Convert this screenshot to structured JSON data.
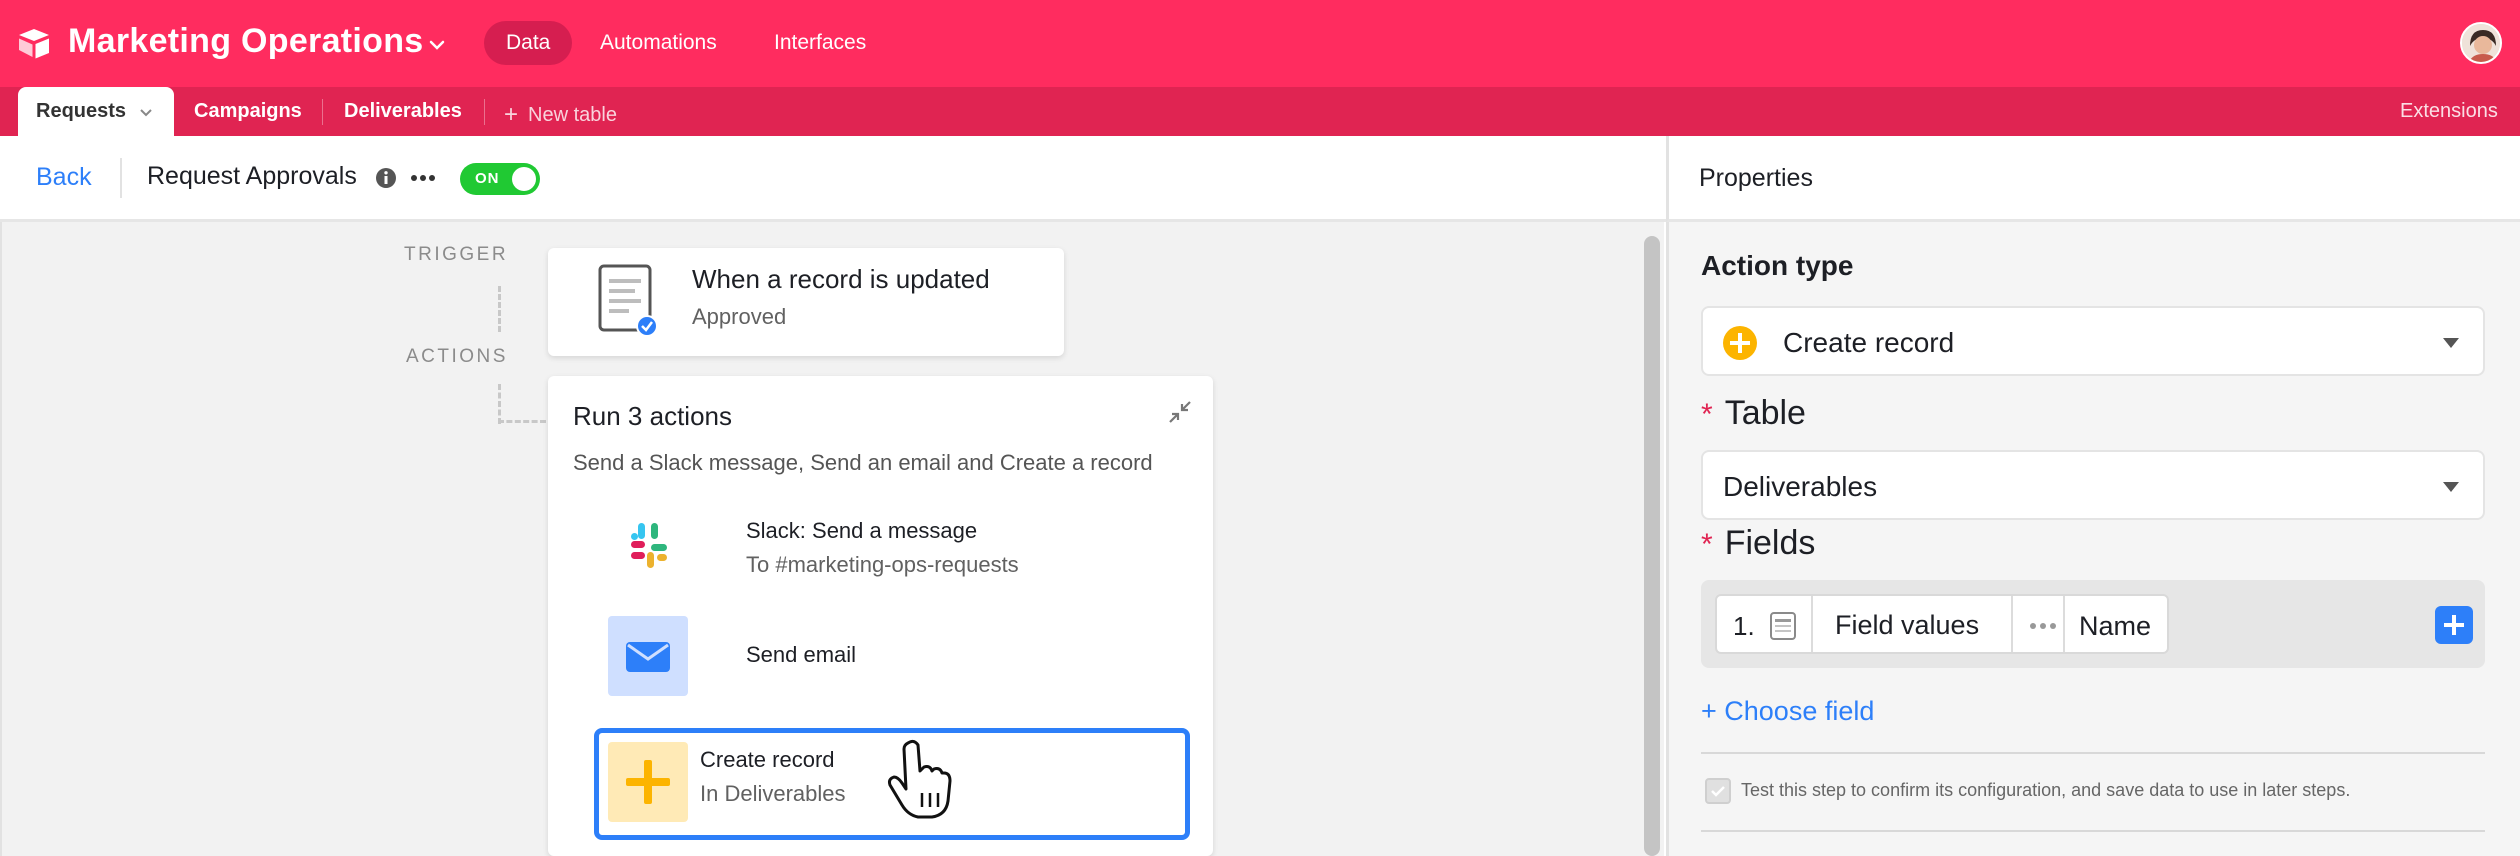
{
  "topbar": {
    "base_name": "Marketing Operations",
    "nav": [
      "Data",
      "Automations",
      "Interfaces"
    ],
    "accent_color": "#ff2c5f"
  },
  "tables": {
    "active": "Requests",
    "others": [
      "Campaigns",
      "Deliverables"
    ],
    "new_table": "New table",
    "extensions": "Extensions"
  },
  "automation": {
    "back": "Back",
    "name": "Request Approvals",
    "toggle": "ON",
    "trigger_label": "TRIGGER",
    "actions_label": "ACTIONS",
    "trigger": {
      "title": "When a record is updated",
      "subtitle": "Approved",
      "icon": "document-check-icon"
    },
    "group": {
      "title": "Run 3 actions",
      "description": "Send a Slack message, Send an email and Create a record"
    },
    "actions": [
      {
        "title": "Slack: Send a message",
        "subtitle": "To #marketing-ops-requests",
        "icon": "slack-icon"
      },
      {
        "title": "Send email",
        "subtitle": "",
        "icon": "envelope-icon"
      },
      {
        "title": "Create record",
        "subtitle": "In Deliverables",
        "icon": "plus-icon"
      }
    ]
  },
  "properties": {
    "title": "Properties",
    "action_type_label": "Action type",
    "action_type_value": "Create record",
    "table_label": "Table",
    "table_value": "Deliverables",
    "fields_label": "Fields",
    "field_row": {
      "number": "1.",
      "type": "Field values",
      "name": "Name"
    },
    "choose_field": "+ Choose field",
    "test_text": "Test this step to confirm its configuration, and save data to use in later steps.",
    "required_marker": "*"
  }
}
